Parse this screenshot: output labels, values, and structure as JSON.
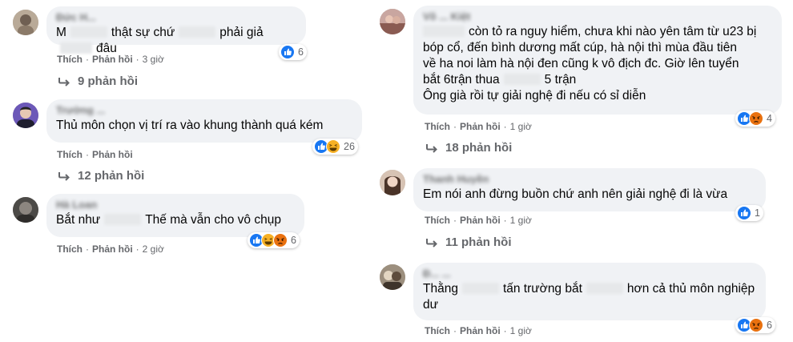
{
  "actions": {
    "like": "Thích",
    "reply": "Phản hồi",
    "sep": "·"
  },
  "comments": [
    {
      "author": "Đức H...",
      "pre": "M",
      "mid": "thật sự chứ",
      "post": "phải giả",
      "tail": "đâu",
      "time": "3 giờ",
      "reactions": [
        "like"
      ],
      "count": "6",
      "replies": "9 phản hồi"
    },
    {
      "author": "Trường ...",
      "text": "Thủ môn chọn vị trí ra vào khung thành quá kém",
      "time": "",
      "reactions": [
        "like",
        "haha"
      ],
      "count": "26",
      "replies": "12 phản hồi"
    },
    {
      "author": "Hà Loan",
      "pre": "Bắt như",
      "post": "Thế mà vẫn cho vô chụp",
      "time": "2 giờ",
      "reactions": [
        "like",
        "haha",
        "angry"
      ],
      "count": "6"
    },
    {
      "author": "Võ ... Kiệt",
      "lines": [
        "còn tỏ ra nguy hiểm, chưa khi nào yên tâm từ u23 bị",
        "bóp cổ, đến bình dương mất cúp, hà nội thì mùa đầu tiên",
        "về ha noi làm hà nội đen cũng k vô địch đc. Giờ lên tuyển",
        "bắt 6trận thua",
        "5 trận",
        "Ông già rồi tự giải nghệ đi nếu có sỉ diễn"
      ],
      "time": "1 giờ",
      "reactions": [
        "like",
        "angry"
      ],
      "count": "4",
      "replies": "18 phản hồi"
    },
    {
      "author": "Thanh Huyền",
      "text": "Em nói anh đừng buồn chứ anh nên giải nghệ đi là vừa",
      "time": "1 giờ",
      "reactions": [
        "like"
      ],
      "count": "1",
      "replies": "11 phản hồi"
    },
    {
      "author": "Đ... ...",
      "pre": "Thằng",
      "mid": "tấn trường bắt",
      "post": "hơn cả thủ môn nghiệp",
      "line2": "dư",
      "time": "1 giờ",
      "reactions": [
        "like",
        "angry"
      ],
      "count": "6"
    }
  ],
  "colors": {
    "bubble": "#f0f2f5",
    "meta": "#65676b",
    "text": "#050505",
    "like": "#1877f2",
    "haha": "#f7b125",
    "angry": "#e9710f"
  }
}
